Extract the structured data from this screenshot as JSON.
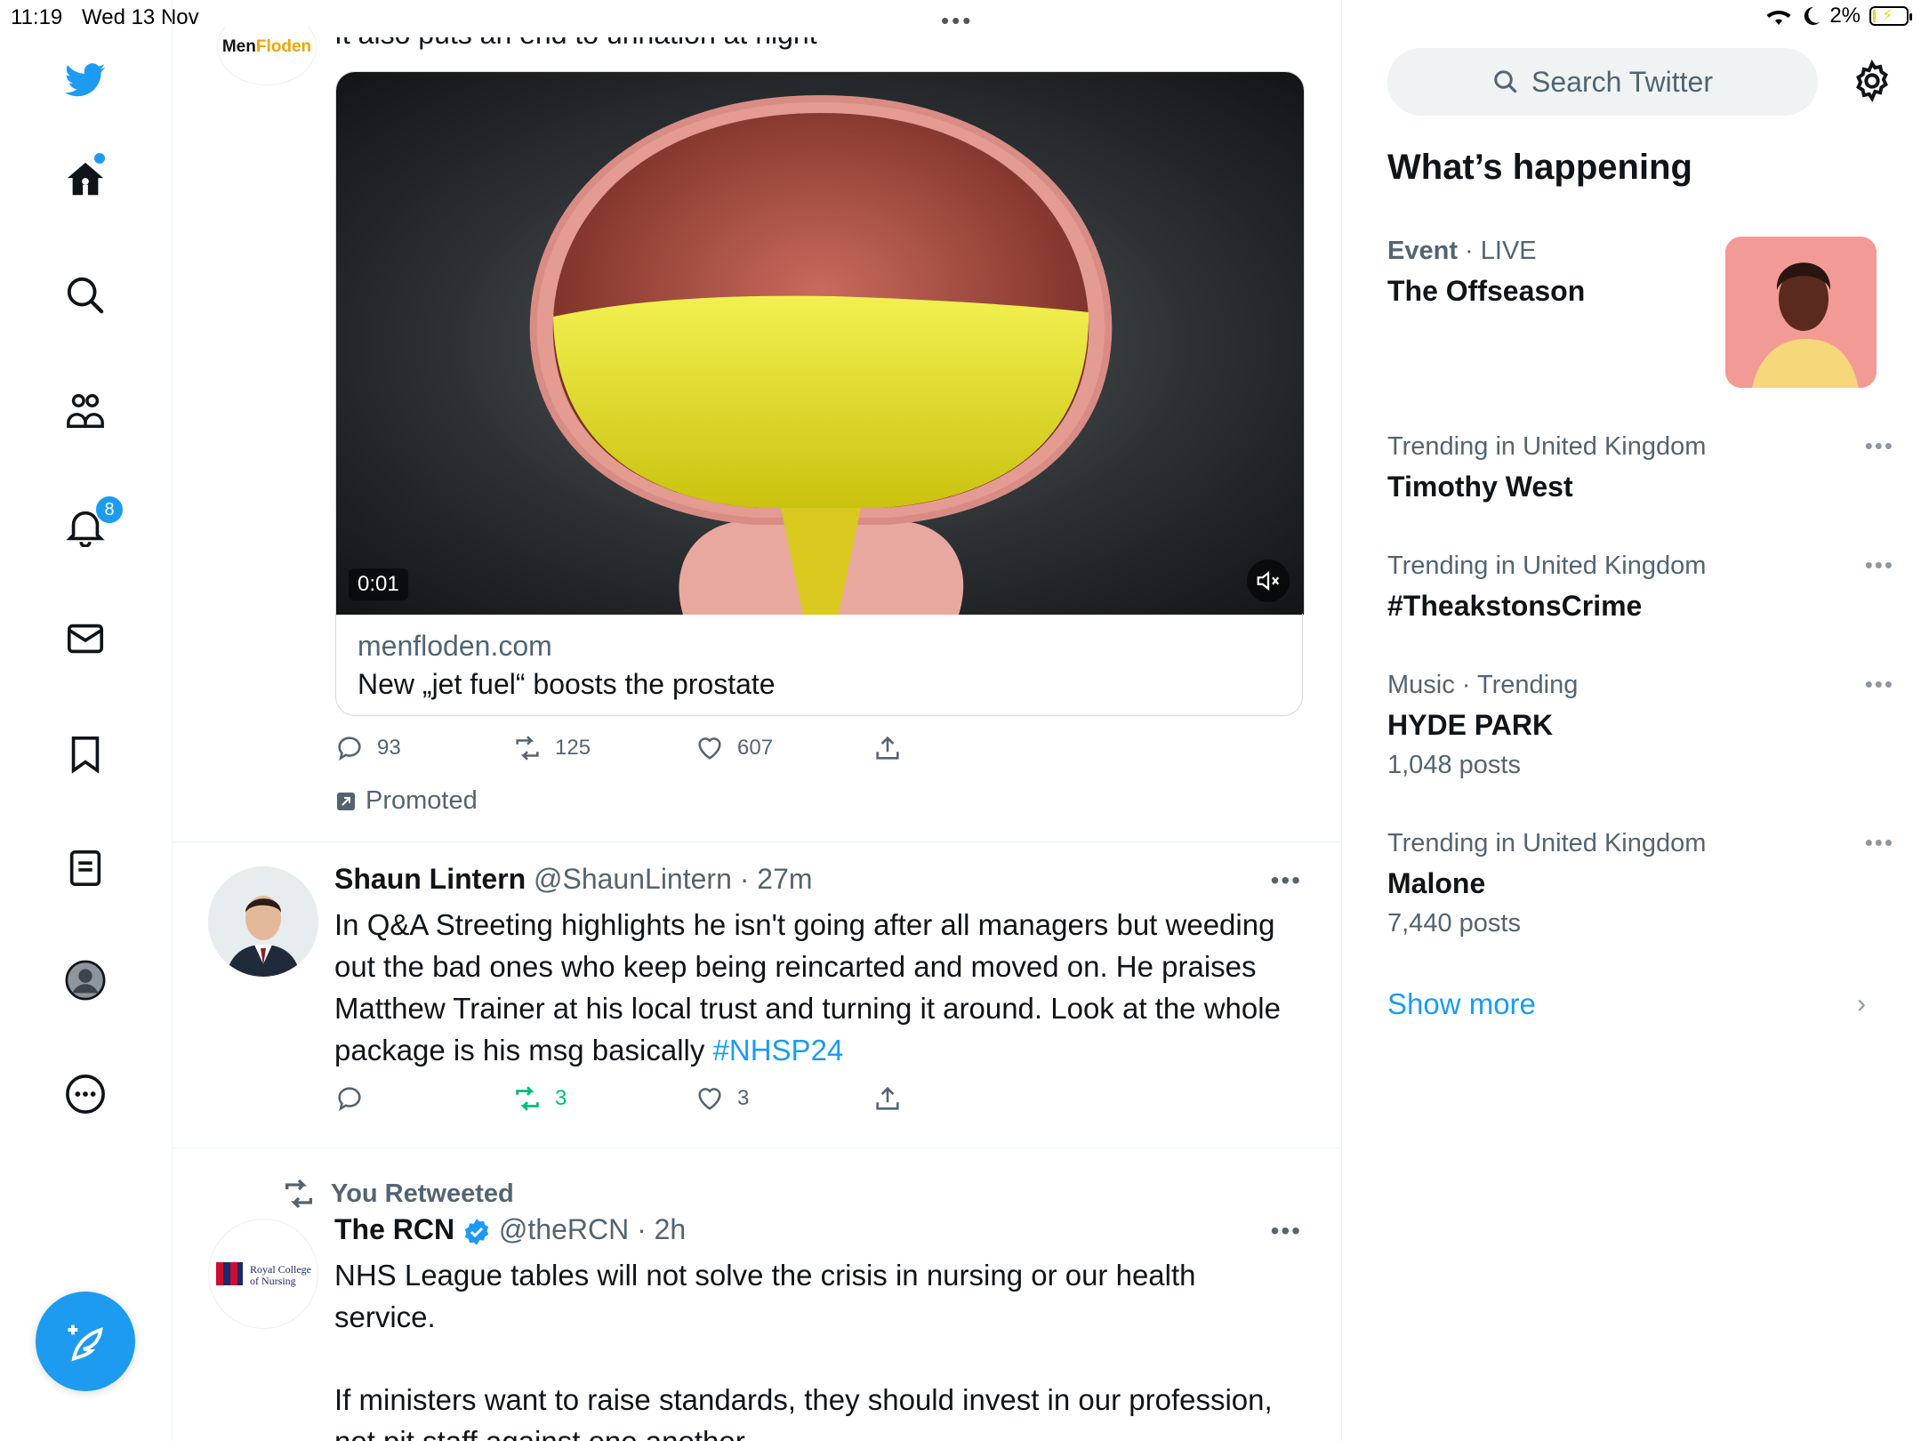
{
  "status_bar": {
    "time": "11:19",
    "date": "Wed 13 Nov",
    "battery": "2%"
  },
  "nav": {
    "notifications_count": "8",
    "icons": [
      "twitter-logo-icon",
      "home-icon",
      "search-icon",
      "communities-icon",
      "notifications-icon",
      "messages-icon",
      "bookmarks-icon",
      "lists-icon",
      "profile-icon",
      "more-icon"
    ]
  },
  "feed": {
    "promoted_tweet": {
      "account_logo_text_a": "Men",
      "account_logo_text_b": "Floden",
      "text_cut": "It also puts an end to urination at night",
      "video_time": "0:01",
      "card_domain": "menfloden.com",
      "card_title": "New „jet fuel“ boosts the prostate",
      "replies": "93",
      "retweets": "125",
      "likes": "607",
      "promoted_label": "Promoted"
    },
    "tweet2": {
      "name": "Shaun Lintern",
      "handle": "@ShaunLintern",
      "time": "· 27m",
      "text": "In Q&A Streeting highlights he isn't going after all managers but weeding out the bad ones who keep being reincarted and moved on. He praises Matthew Trainer at his local trust and turning it around. Look at the whole package is his msg basically ",
      "hashtag": "#NHSP24",
      "replies": "",
      "retweets": "3",
      "likes": "3"
    },
    "tweet3": {
      "retweet_label": "You Retweeted",
      "name": "The RCN",
      "handle": "@theRCN",
      "time": "· 2h",
      "avatar_text_a": "Royal College",
      "avatar_text_b": "of Nursing",
      "text1": "NHS League tables will not solve the crisis in nursing or our health service.",
      "text2": "If ministers want to raise standards, they should invest in our profession, not pit staff against one another."
    }
  },
  "sidebar": {
    "search_placeholder": "Search Twitter",
    "title": "What’s happening",
    "event": {
      "category": "Event",
      "live": "· LIVE",
      "title": "The Offseason"
    },
    "trends": [
      {
        "context": "Trending in United Kingdom",
        "title": "Timothy West",
        "count": ""
      },
      {
        "context": "Trending in United Kingdom",
        "title": "#TheakstonsCrime",
        "count": ""
      },
      {
        "context": "Music · Trending",
        "title": "HYDE PARK",
        "count": "1,048 posts"
      },
      {
        "context": "Trending in United Kingdom",
        "title": "Malone",
        "count": "7,440 posts"
      }
    ],
    "show_more": "Show more"
  },
  "colors": {
    "accent": "#1d9bf0",
    "text": "#0f1419",
    "secondary": "#536471",
    "retweet_green": "#00ba7c"
  }
}
